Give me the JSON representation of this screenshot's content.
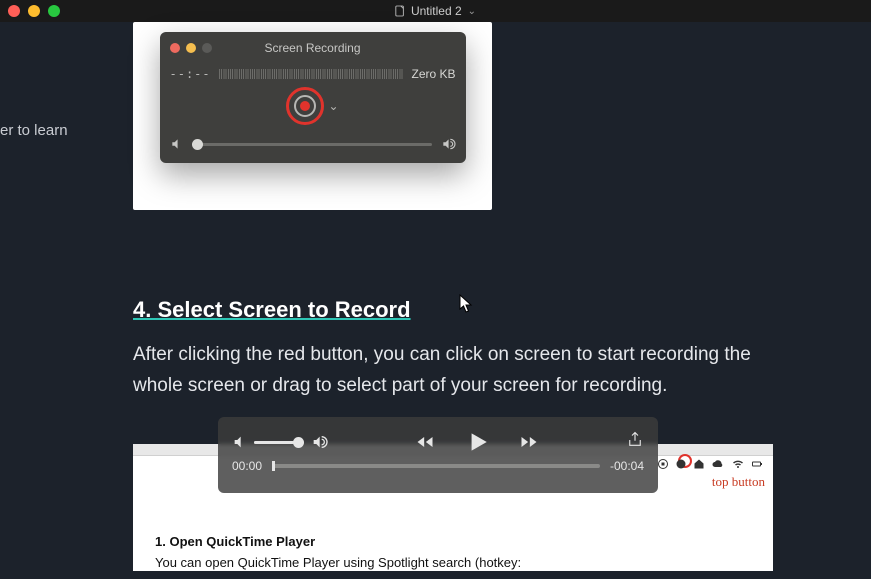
{
  "window": {
    "title": "Untitled 2",
    "dropdown_glyph": "⌄"
  },
  "left_cutoff": "er to learn",
  "quicktime": {
    "title": "Screen Recording",
    "time": "--:--",
    "size": "Zero KB"
  },
  "section": {
    "heading": "4. Select Screen to Record",
    "paragraph": "After clicking the red button, you can click on screen to start recording the whole screen or drag to select part of your screen for recording."
  },
  "player": {
    "current_time": "00:00",
    "remaining": "-00:04"
  },
  "strip": {
    "stop_text": "top button"
  },
  "lower": {
    "heading": "1. Open QuickTime Player",
    "body": "You can open QuickTime Player using Spotlight search (hotkey:"
  }
}
